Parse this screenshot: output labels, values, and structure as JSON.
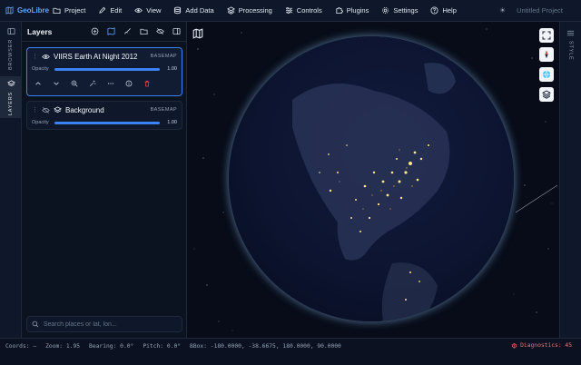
{
  "app": {
    "name": "GeoLibre",
    "project_title": "Untitled Project"
  },
  "menu": [
    {
      "label": "Project",
      "icon": "folder-icon"
    },
    {
      "label": "Edit",
      "icon": "pencil-icon"
    },
    {
      "label": "View",
      "icon": "eye-icon"
    },
    {
      "label": "Add Data",
      "icon": "database-icon"
    },
    {
      "label": "Processing",
      "icon": "layers-icon"
    },
    {
      "label": "Controls",
      "icon": "sliders-icon"
    },
    {
      "label": "Plugins",
      "icon": "puzzle-icon"
    },
    {
      "label": "Settings",
      "icon": "gear-icon"
    },
    {
      "label": "Help",
      "icon": "help-icon"
    }
  ],
  "rail": {
    "browser_label": "BROWSER",
    "layers_label": "LAYERS"
  },
  "panel": {
    "title": "Layers",
    "layers": [
      {
        "name": "VIIRS Earth At Night 2012",
        "badge": "BASEMAP",
        "opacity_label": "Opacity",
        "opacity": 1.0,
        "opacity_text": "1.00",
        "visible": true,
        "selected": true
      },
      {
        "name": "Background",
        "badge": "BASEMAP",
        "opacity_label": "Opacity",
        "opacity": 1.0,
        "opacity_text": "1.00",
        "visible": false,
        "selected": false
      }
    ],
    "search_placeholder": "Search places or lat, lon..."
  },
  "right_rail": {
    "style_label": "STYLE"
  },
  "status": {
    "coords": "Coords: —",
    "zoom": "Zoom: 1.95",
    "bearing": "Bearing: 0.0°",
    "pitch": "Pitch: 0.0°",
    "bbox": "BBox: -180.0000, -38.6675, 180.0000, 90.0000",
    "diagnostics": "Diagnostics: 45"
  },
  "colors": {
    "accent": "#3b82f6",
    "danger": "#ef4444",
    "brand": "#60a5fa"
  }
}
